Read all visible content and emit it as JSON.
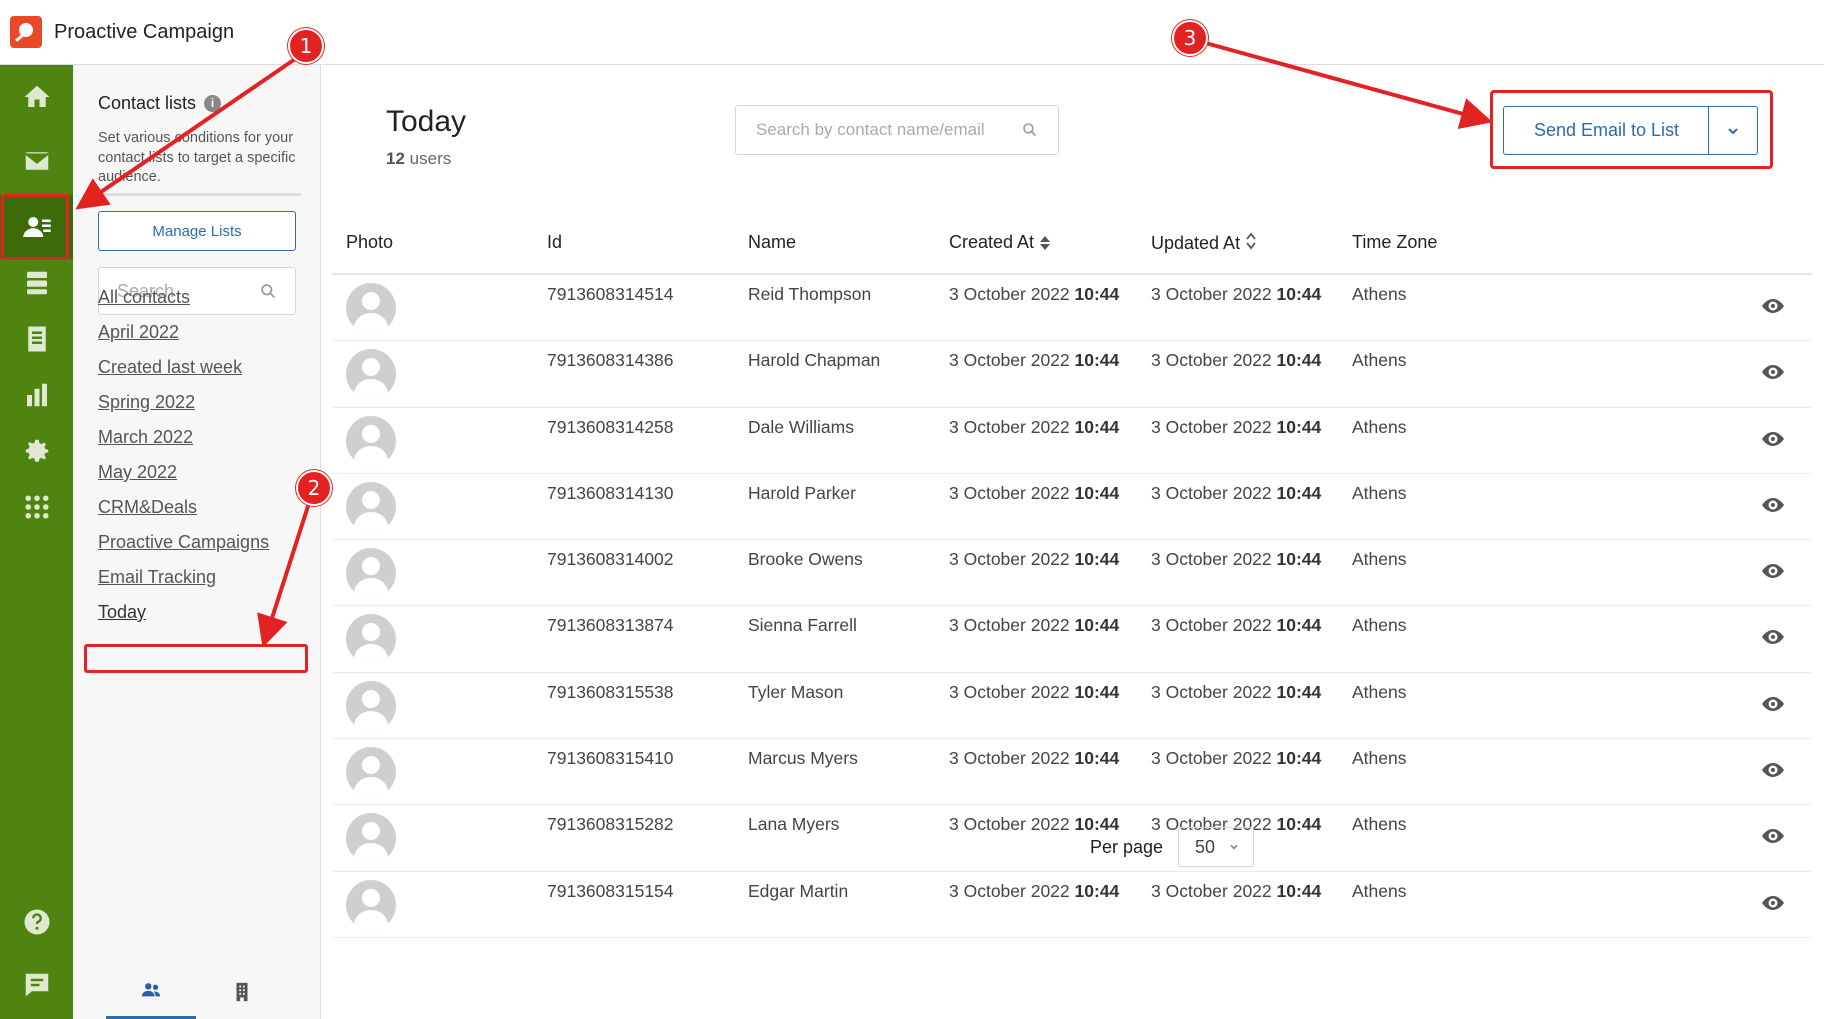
{
  "app": {
    "title": "Proactive Campaign"
  },
  "leftnav": {
    "items": [
      {
        "icon": "home-icon"
      },
      {
        "icon": "mail-icon"
      },
      {
        "icon": "contacts-icon",
        "active": true
      },
      {
        "icon": "stack-icon"
      },
      {
        "icon": "form-icon"
      },
      {
        "icon": "bar-chart-icon"
      },
      {
        "icon": "gear-icon"
      },
      {
        "icon": "apps-grid-icon"
      },
      {
        "icon": "help-icon"
      },
      {
        "icon": "chat-icon"
      }
    ]
  },
  "listpanel": {
    "title": "Contact lists",
    "info_glyph": "i",
    "description": "Set various conditions for your contact lists to target a specific audience.",
    "manage_button": "Manage Lists",
    "search_placeholder": "Search",
    "lists": [
      "All contacts",
      "April 2022",
      "Created last week",
      "Spring 2022",
      "March 2022",
      "May 2022",
      "CRM&Deals",
      "Proactive Campaigns",
      "Email Tracking",
      "Today"
    ]
  },
  "main": {
    "title": "Today",
    "user_count": "12",
    "user_count_suffix": "users",
    "search_placeholder": "Search by contact name/email",
    "send_button": "Send Email to List",
    "columns": [
      "Photo",
      "Id",
      "Name",
      "Created At",
      "Updated At",
      "Time Zone"
    ],
    "rows": [
      {
        "id": "7913608314514",
        "name": "Reid Thompson",
        "created_date": "3 October 2022",
        "created_time": "10:44",
        "updated_date": "3 October 2022",
        "updated_time": "10:44",
        "tz": "Athens"
      },
      {
        "id": "7913608314386",
        "name": "Harold Chapman",
        "created_date": "3 October 2022",
        "created_time": "10:44",
        "updated_date": "3 October 2022",
        "updated_time": "10:44",
        "tz": "Athens"
      },
      {
        "id": "7913608314258",
        "name": "Dale Williams",
        "created_date": "3 October 2022",
        "created_time": "10:44",
        "updated_date": "3 October 2022",
        "updated_time": "10:44",
        "tz": "Athens"
      },
      {
        "id": "7913608314130",
        "name": "Harold Parker",
        "created_date": "3 October 2022",
        "created_time": "10:44",
        "updated_date": "3 October 2022",
        "updated_time": "10:44",
        "tz": "Athens"
      },
      {
        "id": "7913608314002",
        "name": "Brooke Owens",
        "created_date": "3 October 2022",
        "created_time": "10:44",
        "updated_date": "3 October 2022",
        "updated_time": "10:44",
        "tz": "Athens"
      },
      {
        "id": "7913608313874",
        "name": "Sienna Farrell",
        "created_date": "3 October 2022",
        "created_time": "10:44",
        "updated_date": "3 October 2022",
        "updated_time": "10:44",
        "tz": "Athens"
      },
      {
        "id": "7913608315538",
        "name": "Tyler Mason",
        "created_date": "3 October 2022",
        "created_time": "10:44",
        "updated_date": "3 October 2022",
        "updated_time": "10:44",
        "tz": "Athens"
      },
      {
        "id": "7913608315410",
        "name": "Marcus Myers",
        "created_date": "3 October 2022",
        "created_time": "10:44",
        "updated_date": "3 October 2022",
        "updated_time": "10:44",
        "tz": "Athens"
      },
      {
        "id": "7913608315282",
        "name": "Lana Myers",
        "created_date": "3 October 2022",
        "created_time": "10:44",
        "updated_date": "3 October 2022",
        "updated_time": "10:44",
        "tz": "Athens"
      },
      {
        "id": "7913608315154",
        "name": "Edgar Martin",
        "created_date": "3 October 2022",
        "created_time": "10:44",
        "updated_date": "3 October 2022",
        "updated_time": "10:44",
        "tz": "Athens"
      }
    ],
    "per_page_label": "Per page",
    "per_page_value": "50"
  },
  "annotations": {
    "markers": [
      "1",
      "2",
      "3"
    ],
    "color": "#e32222"
  },
  "colors": {
    "nav_green": "#4f8410",
    "accent_blue": "#2b6cb0",
    "highlight_red": "#e32222"
  }
}
